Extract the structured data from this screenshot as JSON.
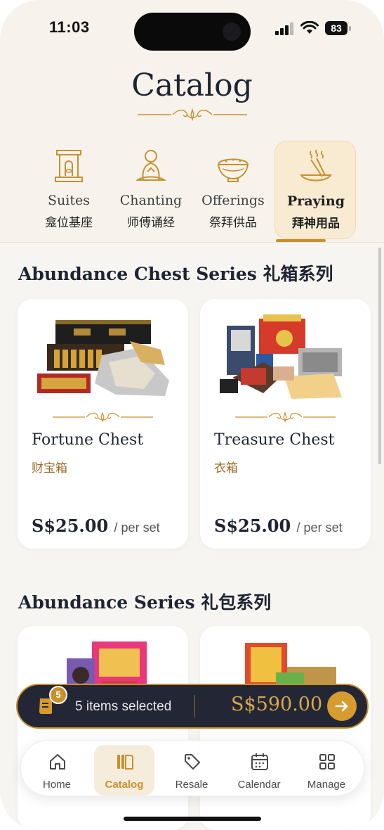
{
  "status_bar": {
    "time": "11:03",
    "battery": "83"
  },
  "page": {
    "title": "Catalog"
  },
  "categories": [
    {
      "en": "Suites",
      "zh": "龛位基座",
      "icon": "shrine-icon",
      "active": false
    },
    {
      "en": "Chanting",
      "zh": "师傅诵经",
      "icon": "monk-icon",
      "active": false
    },
    {
      "en": "Offerings",
      "zh": "祭拜供品",
      "icon": "rice-bowl-icon",
      "active": false
    },
    {
      "en": "Praying",
      "zh": "拜神用品",
      "icon": "incense-icon",
      "active": true
    }
  ],
  "sections": [
    {
      "title": "Abundance Chest Series 礼箱系列",
      "products": [
        {
          "name": "Fortune Chest",
          "zh": "财宝箱",
          "price": "S$25.00",
          "unit": "/ per set"
        },
        {
          "name": "Treasure Chest",
          "zh": "衣箱",
          "price": "S$25.00",
          "unit": "/ per set"
        }
      ]
    },
    {
      "title": "Abundance Series 礼包系列",
      "products": []
    }
  ],
  "cart": {
    "badge": "5",
    "count_text": "5 items selected",
    "total": "S$590.00"
  },
  "nav": [
    {
      "label": "Home",
      "icon": "home-icon",
      "active": false
    },
    {
      "label": "Catalog",
      "icon": "catalog-icon",
      "active": true
    },
    {
      "label": "Resale",
      "icon": "tag-icon",
      "active": false
    },
    {
      "label": "Calendar",
      "icon": "calendar-icon",
      "active": false
    },
    {
      "label": "Manage",
      "icon": "grid-icon",
      "active": false
    }
  ],
  "colors": {
    "accent": "#c8902f",
    "dark": "#232735",
    "header_bg": "#f7f3ec"
  }
}
